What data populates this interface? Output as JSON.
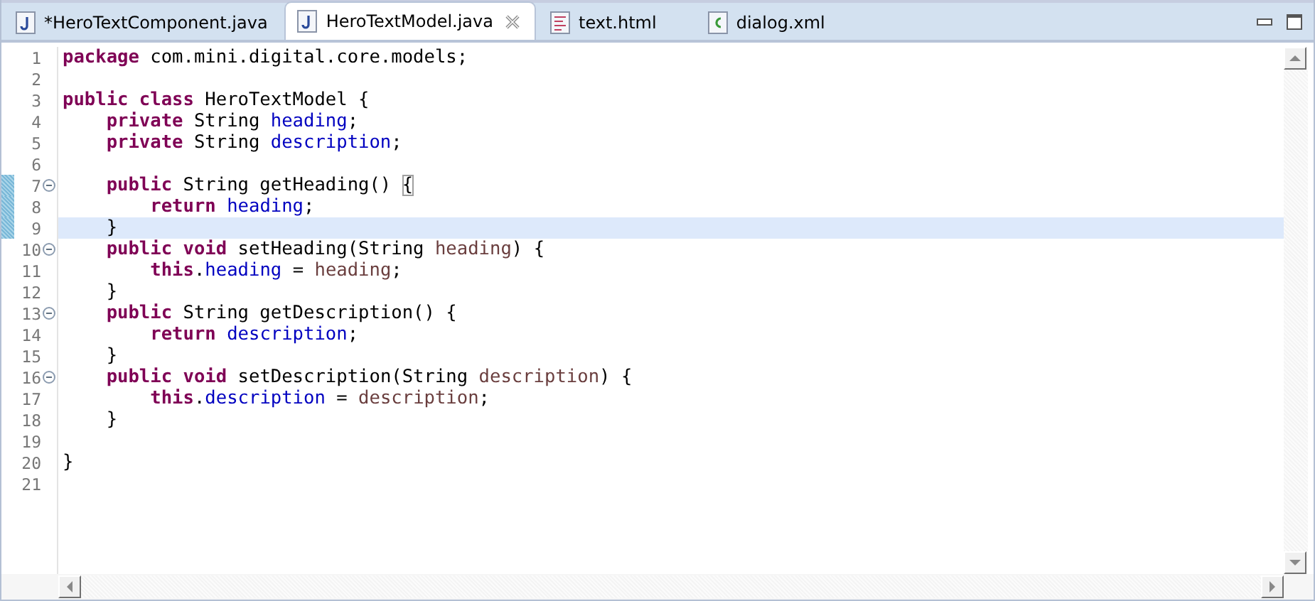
{
  "tabs": [
    {
      "label": "*HeroTextComponent.java",
      "kind": "java",
      "selected": false
    },
    {
      "label": "HeroTextModel.java",
      "kind": "java",
      "selected": true
    },
    {
      "label": "text.html",
      "kind": "html",
      "selected": false
    },
    {
      "label": "dialog.xml",
      "kind": "xml",
      "selected": false
    }
  ],
  "lines": [
    {
      "number": "1",
      "fold": false,
      "changed": false,
      "current": false,
      "tokens": [
        {
          "kind": "keyword",
          "text": "package"
        },
        {
          "kind": "plain",
          "text": " com.mini.digital.core.models;"
        }
      ]
    },
    {
      "number": "2",
      "fold": false,
      "changed": false,
      "current": false
    },
    {
      "number": "3",
      "fold": false,
      "changed": false,
      "current": false,
      "tokens": [
        {
          "kind": "keyword",
          "text": "public class"
        },
        {
          "kind": "plain",
          "text": " HeroTextModel {"
        }
      ]
    },
    {
      "number": "4",
      "fold": false,
      "changed": false,
      "current": false,
      "tokens": [
        {
          "kind": "keyword",
          "text": "    private"
        },
        {
          "kind": "plain",
          "text": " String "
        },
        {
          "kind": "field",
          "text": "heading"
        },
        {
          "kind": "plain",
          "text": ";"
        }
      ]
    },
    {
      "number": "5",
      "fold": false,
      "changed": false,
      "current": false,
      "tokens": [
        {
          "kind": "keyword",
          "text": "    private"
        },
        {
          "kind": "plain",
          "text": " String "
        },
        {
          "kind": "field",
          "text": "description"
        },
        {
          "kind": "plain",
          "text": ";"
        }
      ]
    },
    {
      "number": "6",
      "fold": false,
      "changed": false,
      "current": false
    },
    {
      "number": "7",
      "fold": true,
      "changed": true,
      "current": false,
      "tokens": [
        {
          "kind": "keyword",
          "text": "    public"
        },
        {
          "kind": "plain",
          "text": " String getHeading() "
        },
        {
          "kind": "bracket",
          "text": "{"
        }
      ]
    },
    {
      "number": "8",
      "fold": false,
      "changed": true,
      "current": false,
      "tokens": [
        {
          "kind": "keyword",
          "text": "        return"
        },
        {
          "kind": "field",
          "text": " heading"
        },
        {
          "kind": "plain",
          "text": ";"
        }
      ]
    },
    {
      "number": "9",
      "fold": false,
      "changed": true,
      "current": true,
      "tokens": [
        {
          "kind": "plain",
          "text": "    }"
        }
      ]
    },
    {
      "number": "10",
      "fold": true,
      "changed": false,
      "current": false,
      "tokens": [
        {
          "kind": "keyword",
          "text": "    public void"
        },
        {
          "kind": "plain",
          "text": " setHeading(String "
        },
        {
          "kind": "param",
          "text": "heading"
        },
        {
          "kind": "plain",
          "text": ") {"
        }
      ]
    },
    {
      "number": "11",
      "fold": false,
      "changed": false,
      "current": false,
      "tokens": [
        {
          "kind": "keyword",
          "text": "        this"
        },
        {
          "kind": "plain",
          "text": "."
        },
        {
          "kind": "field",
          "text": "heading"
        },
        {
          "kind": "plain",
          "text": " = "
        },
        {
          "kind": "param",
          "text": "heading"
        },
        {
          "kind": "plain",
          "text": ";"
        }
      ]
    },
    {
      "number": "12",
      "fold": false,
      "changed": false,
      "current": false,
      "tokens": [
        {
          "kind": "plain",
          "text": "    }"
        }
      ]
    },
    {
      "number": "13",
      "fold": true,
      "changed": false,
      "current": false,
      "tokens": [
        {
          "kind": "keyword",
          "text": "    public"
        },
        {
          "kind": "plain",
          "text": " String getDescription() {"
        }
      ]
    },
    {
      "number": "14",
      "fold": false,
      "changed": false,
      "current": false,
      "tokens": [
        {
          "kind": "keyword",
          "text": "        return"
        },
        {
          "kind": "field",
          "text": " description"
        },
        {
          "kind": "plain",
          "text": ";"
        }
      ]
    },
    {
      "number": "15",
      "fold": false,
      "changed": false,
      "current": false,
      "tokens": [
        {
          "kind": "plain",
          "text": "    }"
        }
      ]
    },
    {
      "number": "16",
      "fold": true,
      "changed": false,
      "current": false,
      "tokens": [
        {
          "kind": "keyword",
          "text": "    public void"
        },
        {
          "kind": "plain",
          "text": " setDescription(String "
        },
        {
          "kind": "param",
          "text": "description"
        },
        {
          "kind": "plain",
          "text": ") {"
        }
      ]
    },
    {
      "number": "17",
      "fold": false,
      "changed": false,
      "current": false,
      "tokens": [
        {
          "kind": "keyword",
          "text": "        this"
        },
        {
          "kind": "plain",
          "text": "."
        },
        {
          "kind": "field",
          "text": "description"
        },
        {
          "kind": "plain",
          "text": " = "
        },
        {
          "kind": "param",
          "text": "description"
        },
        {
          "kind": "plain",
          "text": ";"
        }
      ]
    },
    {
      "number": "18",
      "fold": false,
      "changed": false,
      "current": false,
      "tokens": [
        {
          "kind": "plain",
          "text": "    }"
        }
      ]
    },
    {
      "number": "19",
      "fold": false,
      "changed": false,
      "current": false
    },
    {
      "number": "20",
      "fold": false,
      "changed": false,
      "current": false,
      "tokens": [
        {
          "kind": "plain",
          "text": "}"
        }
      ]
    },
    {
      "number": "21",
      "fold": false,
      "changed": false,
      "current": false
    }
  ]
}
